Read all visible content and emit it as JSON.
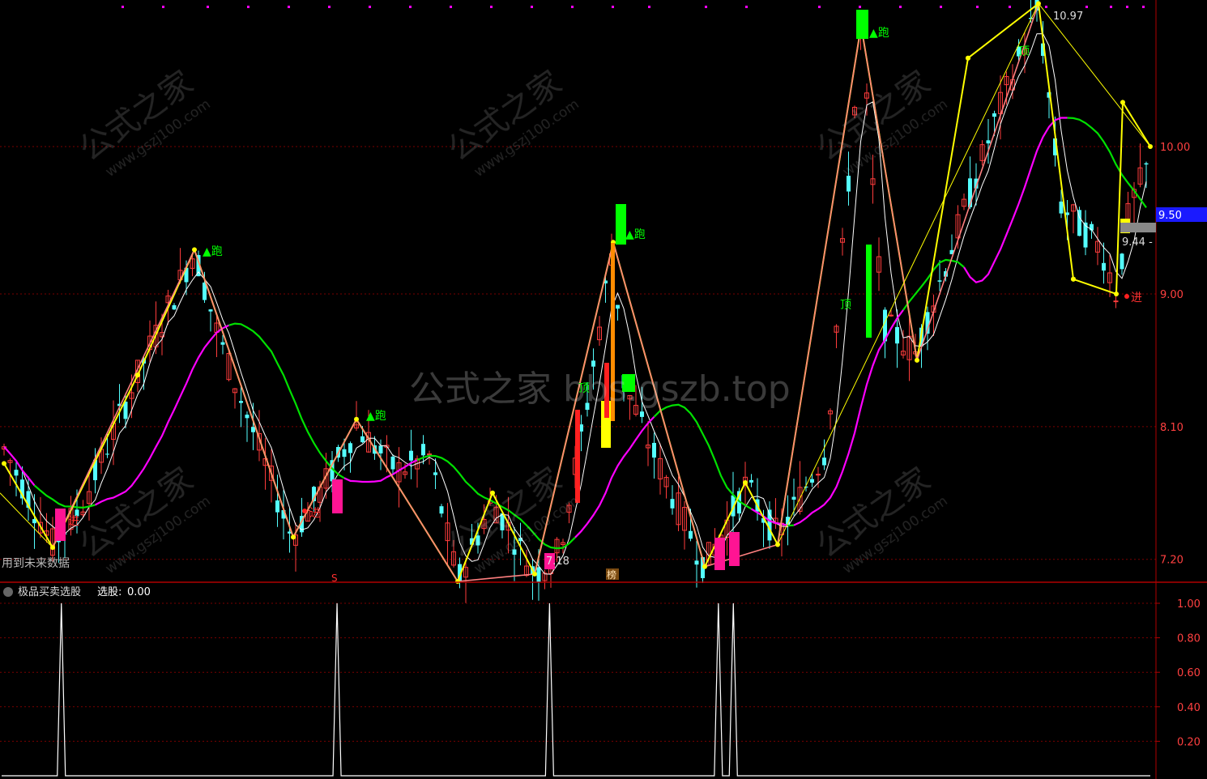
{
  "header": {
    "top_line_hint": "",
    "watermark_center": "公式之家 bbs.gszb.top",
    "watermark_tile_cn": "公式之家",
    "watermark_tile_url": "www.gszj100.com"
  },
  "main_panel": {
    "y_ticks": [
      "10.00",
      "9.00",
      "8.10",
      "7.20"
    ],
    "price_box_label": "9.50",
    "label_future_data": "用到未来数据",
    "label_high": "10.97",
    "label_mid": "9.44 -",
    "label_low": "7.18",
    "tag_run": "▲跑",
    "tag_enter": "进",
    "tag_top": "顶",
    "tag_s": "S",
    "tag_bang": "榜"
  },
  "sub_panel": {
    "indicator_name": "极品买卖选股",
    "series_label": "选股",
    "series_value": "0.00",
    "y_ticks": [
      "1.00",
      "0.80",
      "0.60",
      "0.40",
      "0.20"
    ]
  },
  "colors": {
    "background": "#000000",
    "axis": "#b00000",
    "grid": "#7a0000",
    "up_candle": "#ff3c3c",
    "down_candle": "#54ffff",
    "ma_white": "#ffffff",
    "ma_green": "#00e000",
    "ma_magenta": "#ff00ff",
    "zigzag_yellow": "#ffff00",
    "zigzag_salmon": "#ff8080",
    "signal_green": "#00ff00",
    "signal_pink": "#ff1493",
    "signal_yellow": "#ffff00"
  },
  "chart_data": [
    {
      "type": "candlestick",
      "ylim": [
        7.05,
        10.95
      ],
      "y_ticks": [
        10.0,
        9.0,
        8.1,
        7.2
      ],
      "annotations": {
        "high_label_value": 10.97,
        "low_label_value": 7.18,
        "current_price_box": 9.5,
        "mid_label_value": 9.44
      }
    },
    {
      "type": "line",
      "name": "选股",
      "ylim": [
        0,
        1
      ],
      "y_ticks": [
        1.0,
        0.8,
        0.6,
        0.4,
        0.2
      ],
      "spike_positions_fraction": [
        0.052,
        0.292,
        0.477,
        0.624,
        0.637
      ],
      "spike_values": [
        1,
        1,
        1,
        1,
        1
      ],
      "current_value": 0.0
    }
  ]
}
